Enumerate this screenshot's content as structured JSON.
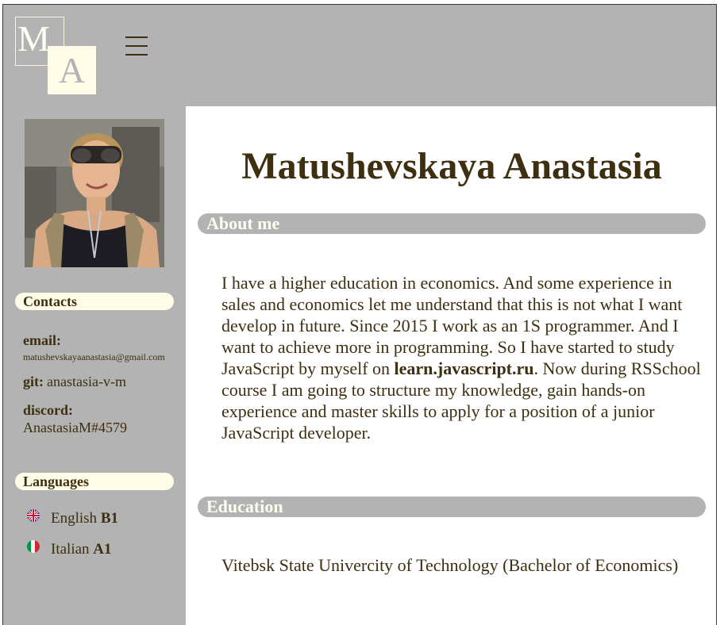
{
  "header": {
    "logo_letter_1": "M",
    "logo_letter_2": "A"
  },
  "sidebar": {
    "contacts_title": "Contacts",
    "email_label": "email:",
    "email_value": "matushevskayaanastasia@gmail.com",
    "git_label": "git:",
    "git_value": "anastasia-v-m",
    "discord_label": "discord:",
    "discord_value": "AnastasiaM#4579",
    "languages_title": "Languages",
    "languages": [
      {
        "name": "English",
        "level": "B1",
        "flag_icon": "uk-flag-icon"
      },
      {
        "name": "Italian",
        "level": "A1",
        "flag_icon": "italy-flag-icon"
      }
    ]
  },
  "main": {
    "name": "Matushevskaya Anastasia",
    "about_title": "About me",
    "about_text_before": "I have a higher education in economics. And some experience in sales and economics let me understand that this is not what I want develop in future. Since 2015 I work as an 1S programmer. And I want to achieve more in programming. So I have started to study JavaScript by myself on ",
    "about_link": "learn.javascript.ru",
    "about_text_after": ". Now during RSSchool course I am going to structure my knowledge, gain hands-on experience and master skills to apply for a position of a junior JavaScript developer.",
    "education_title": "Education",
    "education_text": "Vitebsk State Univercity of Technology (Bachelor of Economics)"
  },
  "colors": {
    "gray": "#b3b3b3",
    "cream": "#fffde8",
    "dark_brown": "#3d2f10"
  }
}
